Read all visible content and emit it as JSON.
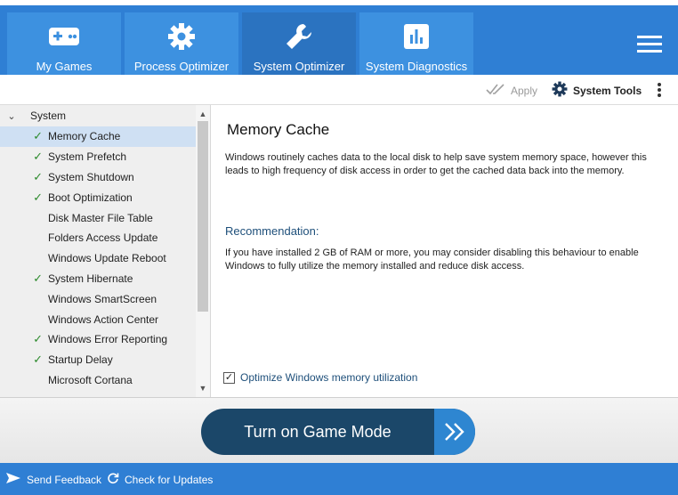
{
  "nav": {
    "tabs": [
      {
        "label": "My Games",
        "icon": "gamepad-icon"
      },
      {
        "label": "Process Optimizer",
        "icon": "gear-icon"
      },
      {
        "label": "System Optimizer",
        "icon": "wrench-icon",
        "active": true
      },
      {
        "label": "System Diagnostics",
        "icon": "bar-chart-icon"
      }
    ],
    "menu_icon": "hamburger-icon"
  },
  "toolbar": {
    "apply_label": "Apply",
    "system_tools_label": "System Tools",
    "more_icon": "kebab-icon"
  },
  "tree": {
    "group_label": "System",
    "items": [
      {
        "label": "Memory Cache",
        "checked": true,
        "selected": true
      },
      {
        "label": "System Prefetch",
        "checked": true
      },
      {
        "label": "System Shutdown",
        "checked": true
      },
      {
        "label": "Boot Optimization",
        "checked": true
      },
      {
        "label": "Disk Master File Table",
        "checked": false
      },
      {
        "label": "Folders Access Update",
        "checked": false
      },
      {
        "label": "Windows Update Reboot",
        "checked": false
      },
      {
        "label": "System Hibernate",
        "checked": true
      },
      {
        "label": "Windows SmartScreen",
        "checked": false
      },
      {
        "label": "Windows Action Center",
        "checked": false
      },
      {
        "label": "Windows Error Reporting",
        "checked": true
      },
      {
        "label": "Startup Delay",
        "checked": true
      },
      {
        "label": "Microsoft Cortana",
        "checked": false
      }
    ]
  },
  "detail": {
    "title": "Memory Cache",
    "description": "Windows routinely caches data to the local disk to help save system memory space, however this leads to high frequency of disk access in order to get the cached data back into the memory.",
    "recommendation_title": "Recommendation:",
    "recommendation_text": "If you have installed 2 GB of RAM or more, you may consider disabling this behaviour to enable Windows to fully utilize the memory installed and reduce disk access.",
    "checkbox_label": "Optimize Windows memory utilization",
    "checkbox_checked": true
  },
  "game_mode": {
    "label": "Turn on Game Mode"
  },
  "status": {
    "feedback_label": "Send Feedback",
    "updates_label": "Check for Updates"
  },
  "colors": {
    "brand_blue": "#2f7fd4",
    "dark_navy": "#1b4769",
    "check_green": "#2e8b2e"
  }
}
